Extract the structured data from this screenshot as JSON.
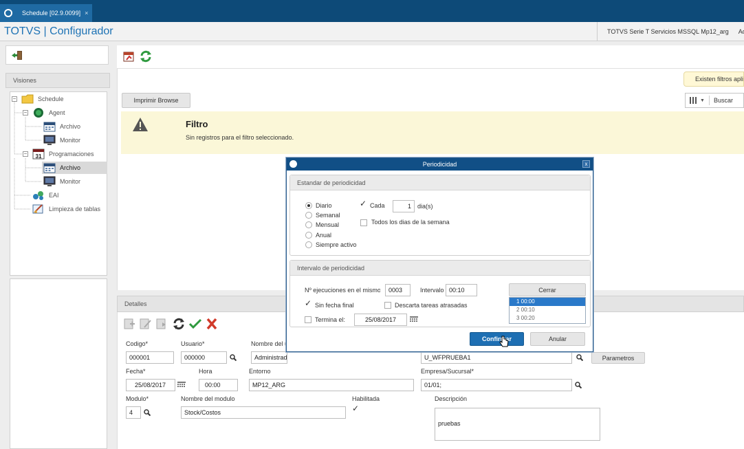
{
  "tab": {
    "title": "Schedule [02.9.0099]",
    "close": "×"
  },
  "app": {
    "title": "TOTVS | Configurador",
    "server": "TOTVS Serie T Servicios MSSQL Mp12_arg",
    "user_trunc": "Adr"
  },
  "left": {
    "visiones": "Visiones",
    "tree": [
      {
        "label": "Schedule",
        "icon": "folder-icon"
      },
      {
        "label": "Agent",
        "icon": "agent-icon"
      },
      {
        "label": "Archivo",
        "icon": "calendar-icon"
      },
      {
        "label": "Monitor",
        "icon": "monitor-icon"
      },
      {
        "label": "Programaciones",
        "icon": "calendar-31-icon"
      },
      {
        "label": "Archivo",
        "icon": "calendar-icon"
      },
      {
        "label": "Monitor",
        "icon": "monitor-icon"
      },
      {
        "label": "EAI",
        "icon": "eai-icon"
      },
      {
        "label": "Limpieza de tablas",
        "icon": "broom-icon"
      }
    ]
  },
  "main": {
    "print_button": "Imprimir Browse",
    "filtros_badge": "Existen filtros aplic",
    "search_placeholder": "Buscar",
    "filter_title": "Filtro",
    "filter_message": "Sin registros para el filtro seleccionado."
  },
  "details": {
    "header": "Detalles",
    "codigo_label": "Codigo*",
    "codigo_value": "000001",
    "usuario_label": "Usuario*",
    "usuario_value": "000000",
    "nombre_us_label": "Nombre del us",
    "nombre_us_value": "Administrador",
    "rutina_value": "U_WFPRUEBA1",
    "parametros_button": "Parametros",
    "fecha_label": "Fecha*",
    "fecha_value": "25/08/2017",
    "hora_label": "Hora",
    "hora_value": "00:00",
    "entorno_label": "Entorno",
    "entorno_value": "MP12_ARG",
    "empresa_label": "Empresa/Sucursal*",
    "empresa_value": "01/01;",
    "modulo_label": "Modulo*",
    "modulo_value": "4",
    "nombre_modulo_label": "Nombre del modulo",
    "nombre_modulo_value": "Stock/Costos",
    "habilitada_label": "Habilitada",
    "habilitada_checked": true,
    "descripcion_label": "Descripción",
    "descripcion_value": "pruebas"
  },
  "dialog": {
    "title": "Periodicidad",
    "close": "x",
    "group1_title": "Estandar de periodicidad",
    "options": [
      "Diario",
      "Semanal",
      "Mensual",
      "Anual",
      "Siempre activo"
    ],
    "selected_option": "Diario",
    "cada_label": "Cada",
    "cada_checked": true,
    "cada_value": "1",
    "dias_label": "dia(s)",
    "todos_label": "Todos los dias de la semana",
    "group2_title": "Intervalo de periodicidad",
    "ejecuciones_label": "Nº ejecuciones en el mismo",
    "ejecuciones_value": "0003",
    "intervalo_label": "Intervalo",
    "intervalo_value": "00:10",
    "cerrar_button": "Cerrar",
    "interval_list": [
      "1  00:00",
      "2  00:10",
      "3  00:20"
    ],
    "sin_fecha_label": "Sin fecha final",
    "sin_fecha_checked": true,
    "descarta_label": "Descarta tareas atrasadas",
    "termina_label": "Termina el:",
    "termina_value": "25/08/2017",
    "confirmar_button": "Confirmar",
    "anular_button": "Anular"
  },
  "colors": {
    "topbar": "#0d4a78",
    "accent": "#1e73b5",
    "banner": "#fbf7d8",
    "dialog_title": "#114f86"
  }
}
